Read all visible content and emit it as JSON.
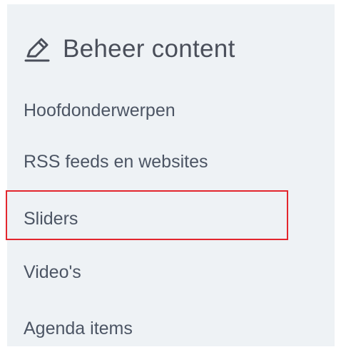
{
  "header": {
    "title": "Beheer content",
    "icon": "pencil-icon"
  },
  "menu": {
    "items": [
      {
        "label": "Hoofdonderwerpen"
      },
      {
        "label": "RSS feeds en websites"
      },
      {
        "label": "Sliders",
        "highlighted": true
      },
      {
        "label": "Video's"
      },
      {
        "label": "Agenda items"
      }
    ]
  },
  "colors": {
    "panel_bg": "#eef2f5",
    "text": "#4c5564",
    "highlight_border": "#e3262d"
  }
}
